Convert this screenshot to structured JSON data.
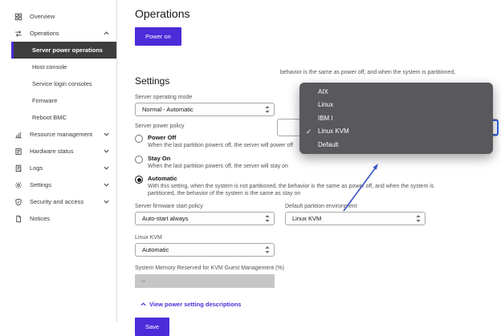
{
  "sidebar": {
    "items": [
      {
        "label": "Overview",
        "icon": "dashboard-icon"
      },
      {
        "label": "Operations",
        "icon": "operations-icon",
        "state": "expanded"
      },
      {
        "label": "Resource management",
        "icon": "resource-management-icon",
        "state": "collapsed"
      },
      {
        "label": "Hardware status",
        "icon": "hardware-status-icon",
        "state": "collapsed"
      },
      {
        "label": "Logs",
        "icon": "logs-icon",
        "state": "collapsed"
      },
      {
        "label": "Settings",
        "icon": "settings-icon",
        "state": "collapsed"
      },
      {
        "label": "Security and access",
        "icon": "security-icon",
        "state": "collapsed"
      },
      {
        "label": "Notices",
        "icon": "notices-icon"
      }
    ],
    "operations_children": [
      {
        "label": "Server power operations",
        "selected": true
      },
      {
        "label": "Host console",
        "selected": false
      },
      {
        "label": "Service login consoles",
        "selected": false
      },
      {
        "label": "Firmware",
        "selected": false
      },
      {
        "label": "Reboot BMC",
        "selected": false
      }
    ]
  },
  "main": {
    "page_title": "Operations",
    "power_on_button": "Power on",
    "settings_heading": "Settings",
    "server_operating_mode": {
      "label": "Server operating mode",
      "value": "Normal - Automatic"
    },
    "server_power_policy": {
      "label": "Server power policy",
      "options": [
        {
          "label": "Power Off",
          "description": "When the last partition powers off, the server will power off",
          "selected": false
        },
        {
          "label": "Stay On",
          "description": "When the last partition powers off, the server will stay on",
          "selected": false
        },
        {
          "label": "Automatic",
          "description": "With this setting, when the system is not partitioned, the behavior is the same as power off, and when the system is partitioned, the behavior of the system is the same as stay on",
          "selected": true
        }
      ]
    },
    "server_firmware_start_policy": {
      "label": "Server firmware start policy",
      "value": "Auto-start always"
    },
    "default_partition_environment": {
      "label": "Default partition environment",
      "value": "Linux KVM"
    },
    "linux_kvm": {
      "label": "Linux KVM",
      "value": "Automatic"
    },
    "system_memory": {
      "label": "System Memory Reserved for KVM Guest Management (%)",
      "value": "--",
      "disabled": true
    },
    "view_descriptions_link": "View power setting descriptions",
    "save_button": "Save"
  },
  "overlay": {
    "context_text": "behavior is the same as power off, and when the system is partitioned,",
    "dropdown": {
      "items": [
        "AIX",
        "Linux",
        "IBM I",
        "Linux KVM",
        "Default"
      ],
      "selected": "Linux KVM",
      "selected_index": 3
    }
  },
  "colors": {
    "primary_purple": "#4c2bd9",
    "dropdown_panel": "#59585c",
    "focus_blue": "#2f62e8",
    "arrow_blue": "#3952c4",
    "selected_nav_bg": "#3d3d3d",
    "disabled_input_bg": "#c6c6c6"
  }
}
